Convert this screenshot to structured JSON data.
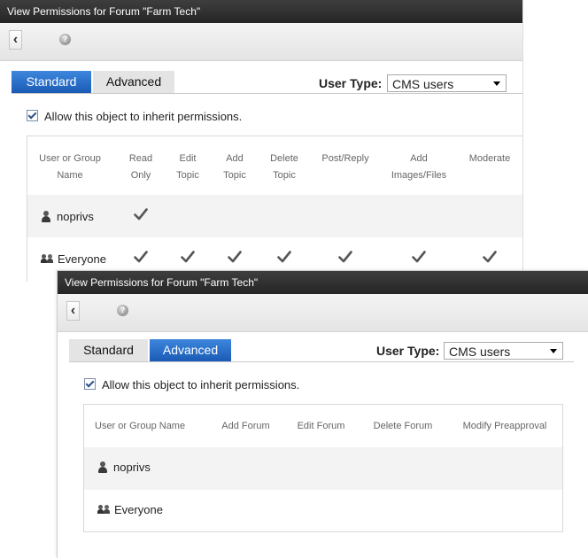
{
  "window1": {
    "title": "View Permissions for Forum \"Farm Tech\"",
    "tabs": [
      {
        "label": "Standard",
        "active": true
      },
      {
        "label": "Advanced",
        "active": false
      }
    ],
    "user_type_label": "User Type:",
    "user_type_value": "CMS users",
    "inherit_label": "Allow this object to inherit permissions.",
    "inherit_checked": true,
    "headers": [
      {
        "lines": [
          "User or Group",
          "Name"
        ]
      },
      {
        "lines": [
          "Read",
          "Only"
        ]
      },
      {
        "lines": [
          "Edit",
          "Topic"
        ]
      },
      {
        "lines": [
          "Add",
          "Topic"
        ]
      },
      {
        "lines": [
          "Delete",
          "Topic"
        ]
      },
      {
        "lines": [
          "Post/Reply",
          ""
        ]
      },
      {
        "lines": [
          "Add",
          "Images/Files"
        ]
      },
      {
        "lines": [
          "Moderate",
          ""
        ]
      }
    ],
    "rows": [
      {
        "name": "noprivs",
        "type": "user",
        "perms": [
          true,
          false,
          false,
          false,
          false,
          false,
          false
        ]
      },
      {
        "name": "Everyone",
        "type": "group",
        "perms": [
          true,
          true,
          true,
          true,
          true,
          true,
          true
        ]
      }
    ]
  },
  "window2": {
    "title": "View Permissions for Forum \"Farm Tech\"",
    "tabs": [
      {
        "label": "Standard",
        "active": false
      },
      {
        "label": "Advanced",
        "active": true
      }
    ],
    "user_type_label": "User Type:",
    "user_type_value": "CMS users",
    "inherit_label": "Allow this object to inherit permissions.",
    "inherit_checked": true,
    "headers": [
      "User or Group Name",
      "Add Forum",
      "Edit Forum",
      "Delete Forum",
      "Modify Preapproval"
    ],
    "rows": [
      {
        "name": "noprivs",
        "type": "user",
        "perms": [
          false,
          false,
          false,
          false
        ]
      },
      {
        "name": "Everyone",
        "type": "group",
        "perms": [
          false,
          false,
          false,
          false
        ]
      }
    ]
  },
  "icons": {
    "back": "back-arrow-icon",
    "help": "help-icon",
    "user": "user-icon",
    "group": "group-icon",
    "check": "checkmark-icon"
  },
  "colors": {
    "active_tab": "#1a5ab5",
    "titlebar": "#2b2b2b",
    "check": "#555555"
  }
}
